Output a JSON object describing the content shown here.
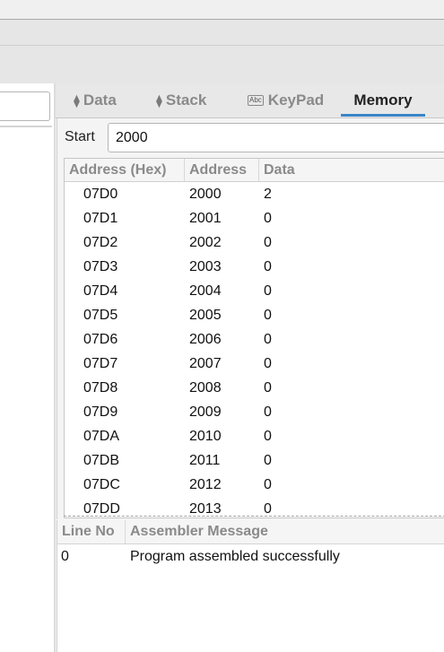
{
  "tabs": {
    "data": "Data",
    "stack": "Stack",
    "keypad": "KeyPad",
    "keypad_icon_text": "Abc",
    "memory": "Memory"
  },
  "memory": {
    "start_label": "Start",
    "start_value": "2000",
    "columns": [
      "Address (Hex)",
      "Address",
      "Data"
    ],
    "rows": [
      [
        "07D0",
        "2000",
        "2"
      ],
      [
        "07D1",
        "2001",
        "0"
      ],
      [
        "07D2",
        "2002",
        "0"
      ],
      [
        "07D3",
        "2003",
        "0"
      ],
      [
        "07D4",
        "2004",
        "0"
      ],
      [
        "07D5",
        "2005",
        "0"
      ],
      [
        "07D6",
        "2006",
        "0"
      ],
      [
        "07D7",
        "2007",
        "0"
      ],
      [
        "07D8",
        "2008",
        "0"
      ],
      [
        "07D9",
        "2009",
        "0"
      ],
      [
        "07DA",
        "2010",
        "0"
      ],
      [
        "07DB",
        "2011",
        "0"
      ],
      [
        "07DC",
        "2012",
        "0"
      ],
      [
        "07DD",
        "2013",
        "0"
      ]
    ]
  },
  "messages": {
    "columns": [
      "Line No",
      "Assembler Message"
    ],
    "rows": [
      [
        "0",
        "Program assembled successfully"
      ]
    ]
  },
  "colors": {
    "active_tab_underline": "#3a86c8",
    "inactive_tab_text": "#8a8a8a"
  }
}
